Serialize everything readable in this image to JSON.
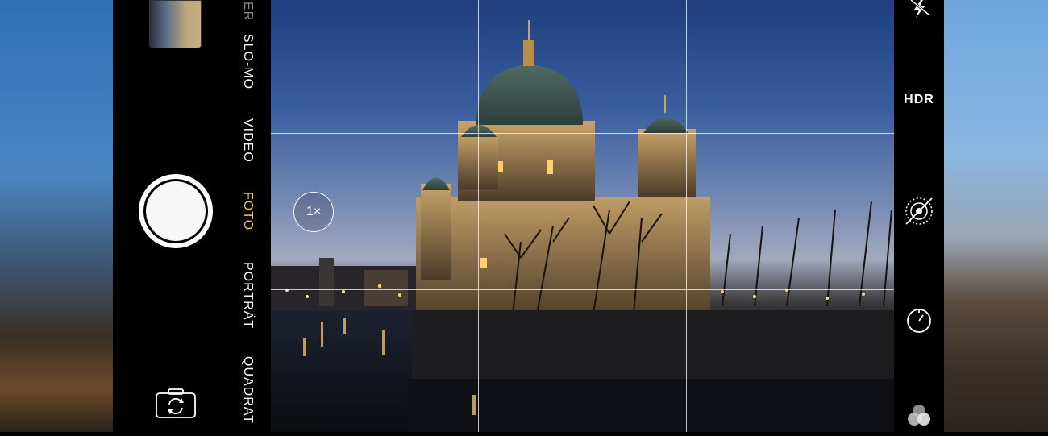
{
  "camera": {
    "modes": [
      {
        "label": "ER",
        "state": "dim"
      },
      {
        "label": "SLO-MO",
        "state": "normal"
      },
      {
        "label": "VIDEO",
        "state": "normal"
      },
      {
        "label": "FOTO",
        "state": "active"
      },
      {
        "label": "PORTRÄT",
        "state": "normal"
      },
      {
        "label": "QUADRAT",
        "state": "normal"
      }
    ],
    "zoom_label": "1×",
    "hdr_label": "HDR"
  },
  "colors": {
    "active_mode": "#f6c643",
    "text": "#ffffff",
    "panel": "#000000"
  },
  "icons": {
    "flash": "flash-off-icon",
    "live_photo": "live-photo-off-icon",
    "timer": "timer-icon",
    "filters": "filters-icon",
    "switch_camera": "switch-camera-icon"
  }
}
